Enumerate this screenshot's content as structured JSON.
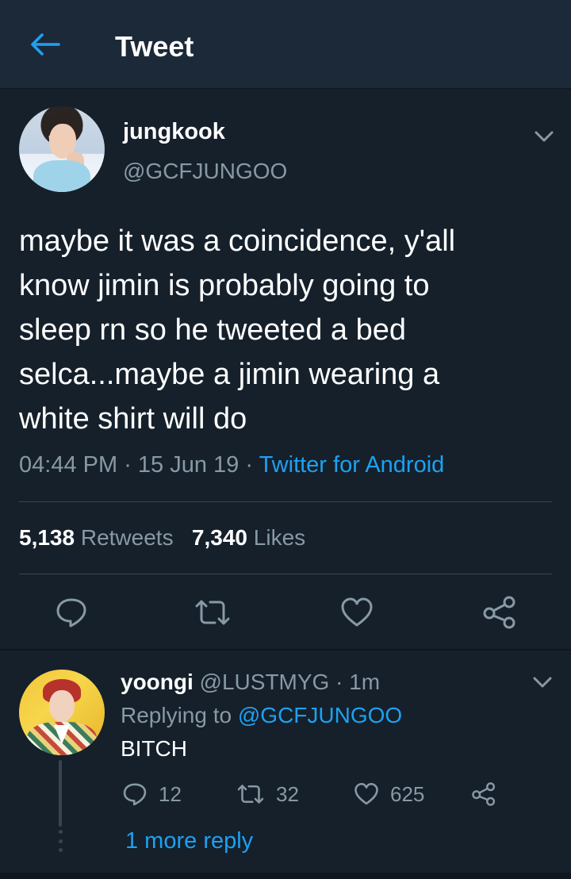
{
  "header": {
    "title": "Tweet",
    "back_icon": "back-arrow-icon",
    "accent": "#1da1f2"
  },
  "main_tweet": {
    "display_name": "jungkook",
    "handle": "@GCFJUNGOO",
    "text": "maybe it was a coincidence, y'all\nknow jimin is probably going to\nsleep rn so he tweeted a bed\nselca...maybe a jimin wearing a\nwhite shirt will do",
    "time": "04:44 PM",
    "sep1": " · ",
    "date": "15 Jun 19",
    "sep2": " · ",
    "source": "Twitter for Android",
    "retweets_count": "5,138",
    "retweets_label": "Retweets",
    "likes_count": "7,340",
    "likes_label": "Likes",
    "actions": [
      "reply-icon",
      "retweet-icon",
      "like-icon",
      "share-icon"
    ]
  },
  "reply": {
    "display_name": "yoongi",
    "handle": "@LUSTMYG",
    "sep": " · ",
    "time": "1m",
    "replying_prefix": "Replying to",
    "replying_to": "@GCFJUNGOO",
    "text": "BITCH",
    "reply_count": "12",
    "retweet_count": "32",
    "like_count": "625",
    "more_replies": "1 more reply"
  },
  "colors": {
    "background": "#15202b",
    "header_bg": "#1c2938",
    "secondary_text": "#8899a6",
    "divider": "#38444d",
    "link": "#1da1f2"
  }
}
